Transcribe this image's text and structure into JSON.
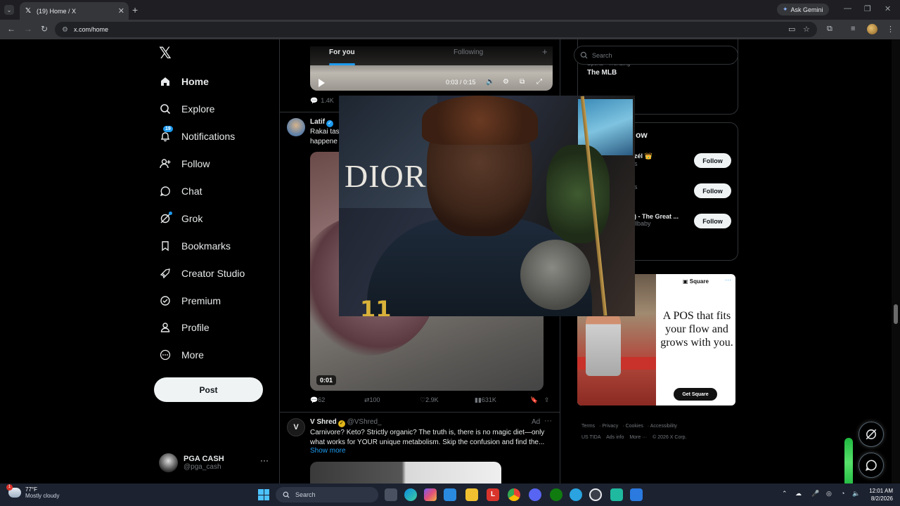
{
  "browser": {
    "tab_title": "(19) Home / X",
    "new_tab": "+",
    "ask_gemini": "Ask Gemini",
    "url": "x.com/home"
  },
  "nav": {
    "items": [
      {
        "label": "Home",
        "icon": "home-icon"
      },
      {
        "label": "Explore",
        "icon": "search-icon"
      },
      {
        "label": "Notifications",
        "icon": "bell-icon",
        "badge": "19"
      },
      {
        "label": "Follow",
        "icon": "person-add-icon"
      },
      {
        "label": "Chat",
        "icon": "chat-icon"
      },
      {
        "label": "Grok",
        "icon": "grok-icon"
      },
      {
        "label": "Bookmarks",
        "icon": "bookmark-icon"
      },
      {
        "label": "Creator Studio",
        "icon": "rocket-icon"
      },
      {
        "label": "Premium",
        "icon": "verified-icon"
      },
      {
        "label": "Profile",
        "icon": "person-icon"
      },
      {
        "label": "More",
        "icon": "more-circle-icon"
      }
    ],
    "post_label": "Post",
    "account_name": "PGA CASH",
    "account_handle": "@pga_cash",
    "account_more": "···"
  },
  "feed": {
    "tabs": [
      "For you",
      "Following"
    ],
    "active_tab": "For you",
    "video_time": "0:03 / 0:15",
    "prev_replies": "1.4K",
    "tweet1": {
      "name": "Latif",
      "text_line1": "Rakai tas",
      "text_line2": "happene",
      "duration": "0:01",
      "replies": "62",
      "reposts": "100",
      "likes": "2.9K",
      "views": "631K"
    },
    "tweet2": {
      "name": "V Shred",
      "handle": "@VShred_",
      "ad_label": "Ad",
      "text_line1": "Carnivore? Keto? Strictly organic? The truth is, there is no magic diet—only",
      "text_line2": "what works for YOUR unique metabolism. Skip the confusion and find the...",
      "show_more": "Show more"
    }
  },
  "right": {
    "search_placeholder": "Search",
    "trend_category": "Sports · Trending",
    "trend_name": "The MLB",
    "who_title": "ow",
    "who": [
      {
        "name": "zél 👑",
        "sub": "s",
        "button": "Follow"
      },
      {
        "name": "",
        "sub": "s",
        "button": "Follow"
      },
      {
        "name": ") - The Great ...",
        "sub": "llbaby",
        "button": "Follow"
      }
    ],
    "ad": {
      "brand": "Square",
      "headline": "A POS that fits your flow and grows with you.",
      "cta": "Get Square"
    },
    "footer": [
      "Terms",
      "Privacy",
      "Cookies",
      "Accessibility",
      "US TIDA",
      "Ads info",
      "More ···",
      "© 2026 X Corp."
    ]
  },
  "taskbar": {
    "temp": "77°F",
    "condition": "Mostly cloudy",
    "weather_badge": "1",
    "search_label": "Search",
    "time": "12:01 AM",
    "date": "8/2/2026"
  },
  "colors": {
    "accent": "#1d9bf0",
    "background": "#000000",
    "taskbar": "#1c2230"
  }
}
